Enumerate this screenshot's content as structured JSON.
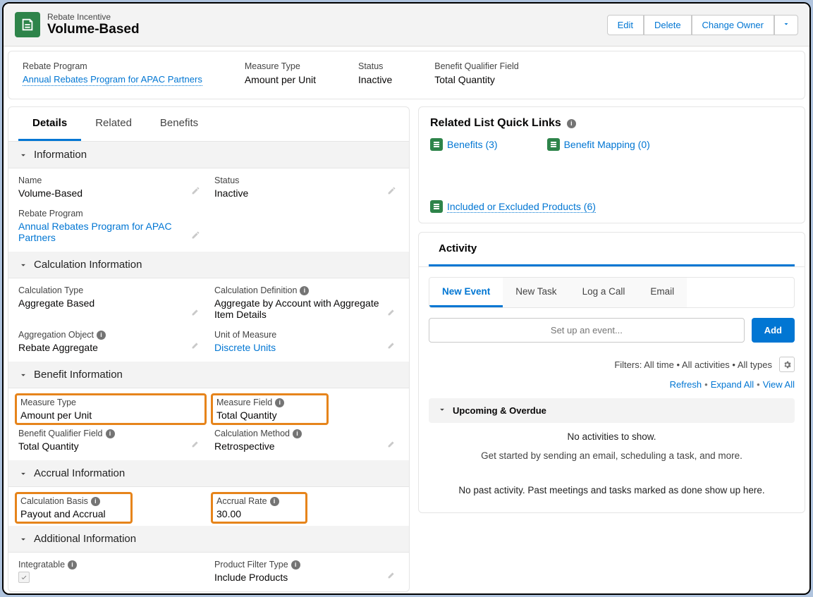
{
  "header": {
    "record_type": "Rebate Incentive",
    "record_name": "Volume-Based",
    "buttons": {
      "edit": "Edit",
      "delete": "Delete",
      "change_owner": "Change Owner"
    }
  },
  "highlights": {
    "rebate_program_label": "Rebate Program",
    "rebate_program_value": "Annual Rebates Program for APAC Partners",
    "measure_type_label": "Measure Type",
    "measure_type_value": "Amount per Unit",
    "status_label": "Status",
    "status_value": "Inactive",
    "bqf_label": "Benefit Qualifier Field",
    "bqf_value": "Total Quantity"
  },
  "tabs": {
    "details": "Details",
    "related": "Related",
    "benefits": "Benefits"
  },
  "sections": {
    "information": "Information",
    "calculation": "Calculation Information",
    "benefit": "Benefit Information",
    "accrual": "Accrual Information",
    "additional": "Additional Information"
  },
  "fields": {
    "name_label": "Name",
    "name_value": "Volume-Based",
    "status_label": "Status",
    "status_value": "Inactive",
    "rebate_program_label": "Rebate Program",
    "rebate_program_value": "Annual Rebates Program for APAC Partners",
    "calc_type_label": "Calculation Type",
    "calc_type_value": "Aggregate Based",
    "calc_def_label": "Calculation Definition",
    "calc_def_value": "Aggregate by Account with Aggregate Item Details",
    "agg_obj_label": "Aggregation Object",
    "agg_obj_value": "Rebate Aggregate",
    "uom_label": "Unit of Measure",
    "uom_value": "Discrete Units",
    "measure_type_label": "Measure Type",
    "measure_type_value": "Amount per Unit",
    "measure_field_label": "Measure Field",
    "measure_field_value": "Total Quantity",
    "bqf_label": "Benefit Qualifier Field",
    "bqf_value": "Total Quantity",
    "calc_method_label": "Calculation Method",
    "calc_method_value": "Retrospective",
    "calc_basis_label": "Calculation Basis",
    "calc_basis_value": "Payout and Accrual",
    "accrual_rate_label": "Accrual Rate",
    "accrual_rate_value": "30.00",
    "integratable_label": "Integratable",
    "pft_label": "Product Filter Type",
    "pft_value": "Include Products"
  },
  "related_quick_links": {
    "title": "Related List Quick Links",
    "benefits": "Benefits (3)",
    "mapping": "Benefit Mapping (0)",
    "products": "Included or Excluded Products (6)"
  },
  "activity": {
    "title": "Activity",
    "subtabs": {
      "new_event": "New Event",
      "new_task": "New Task",
      "log_call": "Log a Call",
      "email": "Email"
    },
    "input_placeholder": "Set up an event...",
    "add_label": "Add",
    "filters": "Filters: All time • All activities • All types",
    "refresh": "Refresh",
    "expand": "Expand All",
    "view_all": "View All",
    "upcoming": "Upcoming & Overdue",
    "no_activities": "No activities to show.",
    "get_started": "Get started by sending an email, scheduling a task, and more.",
    "no_past": "No past activity. Past meetings and tasks marked as done show up here."
  }
}
